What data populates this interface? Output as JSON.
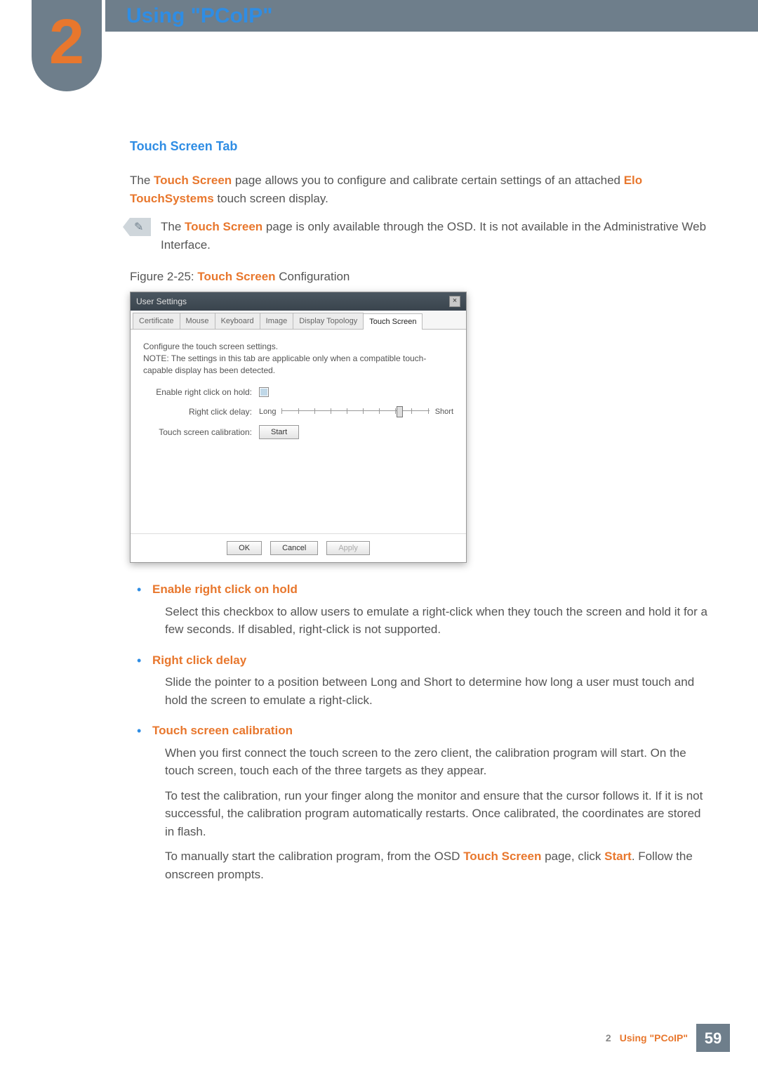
{
  "chapter": {
    "number": "2",
    "title": "Using \"PCoIP\""
  },
  "section": {
    "title": "Touch Screen Tab",
    "intro_parts": [
      "The ",
      "Touch Screen",
      " page allows you to configure and calibrate certain settings of an attached ",
      "Elo TouchSystems",
      " touch screen display."
    ],
    "note_parts": [
      "The ",
      "Touch Screen",
      " page is only available through the OSD. It is not available in the Administrative Web Interface."
    ],
    "figure_caption_parts": [
      "Figure 2-25: ",
      "Touch Screen",
      " Configuration"
    ]
  },
  "dialog": {
    "title": "User Settings",
    "close": "×",
    "tabs": [
      "Certificate",
      "Mouse",
      "Keyboard",
      "Image",
      "Display Topology",
      "Touch Screen"
    ],
    "active_tab_index": 5,
    "body_text": "Configure the touch screen settings.\nNOTE: The settings in this tab are applicable only when a compatible touch-capable display has been detected.",
    "rows": {
      "enable_label": "Enable right click on hold:",
      "delay_label": "Right click delay:",
      "delay_long": "Long",
      "delay_short": "Short",
      "calib_label": "Touch screen calibration:",
      "start_button": "Start"
    },
    "buttons": {
      "ok": "OK",
      "cancel": "Cancel",
      "apply": "Apply"
    }
  },
  "features": [
    {
      "title": "Enable right click on hold",
      "paras": [
        "Select this checkbox to allow users to emulate a right-click when they touch the screen and hold it for a few seconds. If disabled, right-click is not supported."
      ]
    },
    {
      "title": "Right click delay",
      "paras": [
        "Slide the pointer to a position between Long and Short to determine how long a user must touch and hold the screen to emulate a right-click."
      ]
    },
    {
      "title": "Touch screen calibration",
      "paras": [
        "When you first connect the touch screen to the zero client, the calibration program will start. On the touch screen, touch each of the three targets as they appear.",
        "To test the calibration, run your finger along the monitor and ensure that the cursor follows it. If it is not successful, the calibration program automatically restarts. Once calibrated, the coordinates are stored in flash."
      ],
      "final_parts": [
        "To manually start the calibration program, from the OSD ",
        "Touch Screen",
        " page, click ",
        "Start",
        ". Follow the onscreen prompts."
      ]
    }
  ],
  "footer": {
    "chapter_num": "2",
    "chapter_title": "Using \"PCoIP\"",
    "page": "59"
  }
}
